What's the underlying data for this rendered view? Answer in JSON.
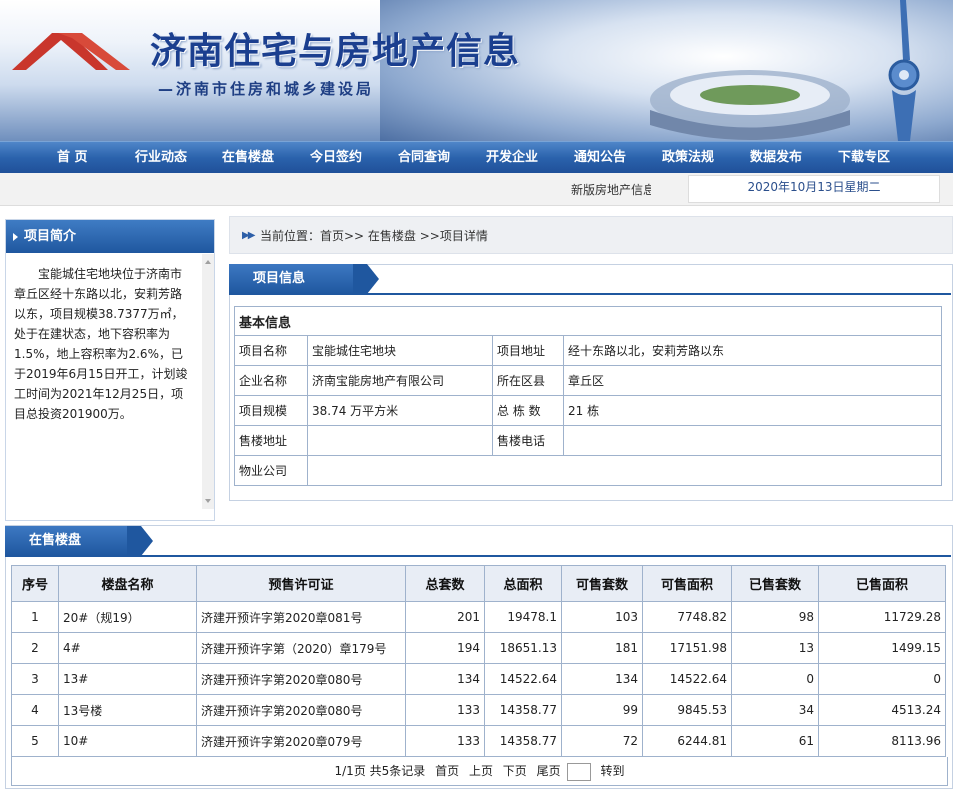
{
  "header": {
    "site_title": "济南住宅与房地产信息",
    "subtitle": "—济南市住房和城乡建设局"
  },
  "nav": {
    "items": [
      "首 页",
      "行业动态",
      "在售楼盘",
      "今日签约",
      "合同查询",
      "开发企业",
      "通知公告",
      "政策法规",
      "数据发布",
      "下载专区"
    ]
  },
  "topbar": {
    "marquee": "新版房地产信息",
    "date": "2020年10月13日星期二"
  },
  "sidebar": {
    "title": "项目简介",
    "intro": "宝能城住宅地块位于济南市章丘区经十东路以北，安莉芳路以东，项目规模38.7377万㎡，处于在建状态，地下容积率为1.5%，地上容积率为2.6%，已于2019年6月15日开工，计划竣工时间为2021年12月25日，项目总投资201900万。"
  },
  "breadcrumb": {
    "text": "当前位置：首页>> 在售楼盘 >>项目详情"
  },
  "project": {
    "section_title": "项目信息",
    "basic_title": "基本信息",
    "name_label": "项目名称",
    "name": "宝能城住宅地块",
    "address_label": "项目地址",
    "address": "经十东路以北，安莉芳路以东",
    "company_label": "企业名称",
    "company": "济南宝能房地产有限公司",
    "district_label": "所在区县",
    "district": "章丘区",
    "scale_label": "项目规模",
    "scale": "38.74 万平方米",
    "buildings_label": "总 栋 数",
    "buildings": "21 栋",
    "sales_addr_label": "售楼地址",
    "sales_addr": "",
    "sales_phone_label": "售楼电话",
    "sales_phone": "",
    "property_label": "物业公司",
    "property": ""
  },
  "sales": {
    "section_title": "在售楼盘",
    "headers": [
      "序号",
      "楼盘名称",
      "预售许可证",
      "总套数",
      "总面积",
      "可售套数",
      "可售面积",
      "已售套数",
      "已售面积"
    ],
    "rows": [
      [
        "1",
        "20#（规19）",
        "济建开预许字第2020章081号",
        "201",
        "19478.1",
        "103",
        "7748.82",
        "98",
        "11729.28"
      ],
      [
        "2",
        "4#",
        "济建开预许字第（2020）章179号",
        "194",
        "18651.13",
        "181",
        "17151.98",
        "13",
        "1499.15"
      ],
      [
        "3",
        "13#",
        "济建开预许字第2020章080号",
        "134",
        "14522.64",
        "134",
        "14522.64",
        "0",
        "0"
      ],
      [
        "4",
        "13号楼",
        "济建开预许字第2020章080号",
        "133",
        "14358.77",
        "99",
        "9845.53",
        "34",
        "4513.24"
      ],
      [
        "5",
        "10#",
        "济建开预许字第2020章079号",
        "133",
        "14358.77",
        "72",
        "6244.81",
        "61",
        "8113.96"
      ]
    ],
    "pager": {
      "summary": "1/1页 共5条记录",
      "first": "首页",
      "prev": "上页",
      "next": "下页",
      "last": "尾页",
      "goto": "转到",
      "page_input": ""
    }
  }
}
